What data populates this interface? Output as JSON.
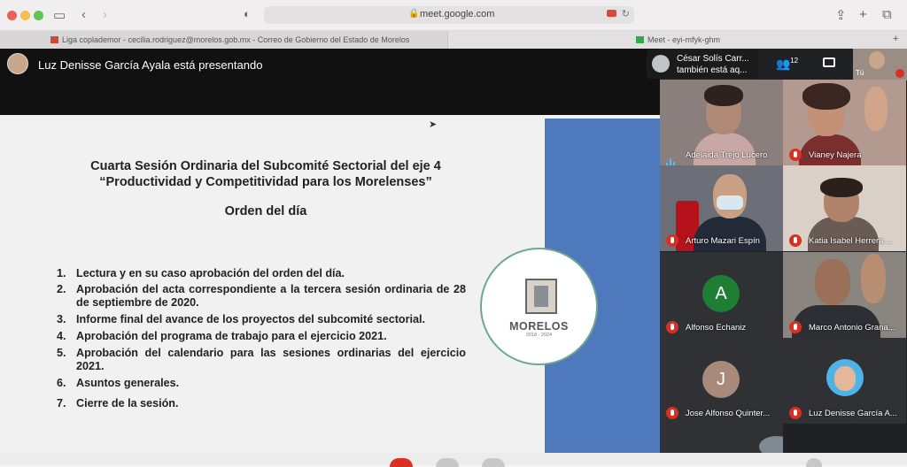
{
  "browser": {
    "url": "meet.google.com",
    "tabs": [
      {
        "label": "Liga coplademor - cecilia.rodriguez@morelos.gob.mx - Correo de Gobierno del Estado de Morelos"
      },
      {
        "label": "Meet - eyi-mfyk-ghm"
      }
    ]
  },
  "meet": {
    "presenting_label": "Luz Denisse García Ayala está presentando",
    "also_presenting": {
      "line1": "César Solís Carr...",
      "line2": "también está aq..."
    },
    "participant_count": "12",
    "self_label": "Tú"
  },
  "slide": {
    "title_line1": "Cuarta Sesión Ordinaria del Subcomité Sectorial del eje 4",
    "title_line2": "“Productividad y Competitividad para los Morelenses”",
    "subtitle": "Orden del día",
    "agenda": [
      {
        "num": "1.",
        "text": "Lectura y en su caso aprobación del orden del día."
      },
      {
        "num": "2.",
        "text": "Aprobación del acta correspondiente a la tercera sesión ordinaria de 28 de septiembre de 2020."
      },
      {
        "num": "3.",
        "text": "Informe final del avance de los proyectos del subcomité sectorial."
      },
      {
        "num": "4.",
        "text": "Aprobación del programa de trabajo para el ejercicio 2021."
      },
      {
        "num": "5.",
        "text": "Aprobación del calendario para las sesiones ordinarias del ejercicio 2021."
      },
      {
        "num": "6.",
        "text": "Asuntos generales."
      },
      {
        "num": "7.",
        "text": "Cierre de la sesión."
      }
    ],
    "logo_text": "MORELOS",
    "logo_years": "2018 - 2024"
  },
  "participants": [
    {
      "name": "Adelaida Trejo Lucero",
      "state": "speaking"
    },
    {
      "name": "Vianey Najera",
      "state": "muted"
    },
    {
      "name": "Arturo Mazari Espín",
      "state": "muted"
    },
    {
      "name": "Katia Isabel Herrera ...",
      "state": "muted"
    },
    {
      "name": "Alfonso Echaniz",
      "state": "muted",
      "initial": "A"
    },
    {
      "name": "Marco Antonio Grana...",
      "state": "muted"
    },
    {
      "name": "Jose Alfonso Quinter...",
      "state": "muted",
      "initial": "J"
    },
    {
      "name": "Luz Denisse García A...",
      "state": "muted"
    }
  ],
  "colors": {
    "accent_blue": "#4f79bd",
    "mute_red": "#d93025",
    "logo_ring": "#6ea88e"
  }
}
